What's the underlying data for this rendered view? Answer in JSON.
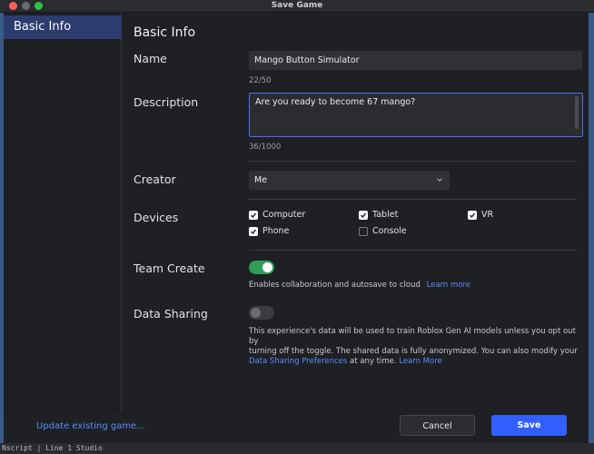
{
  "window": {
    "title": "Save Game"
  },
  "sidebar": {
    "items": [
      {
        "label": "Basic Info"
      }
    ]
  },
  "section": {
    "title": "Basic Info"
  },
  "name": {
    "label": "Name",
    "value": "Mango Button Simulator",
    "counter": "22/50"
  },
  "description": {
    "label": "Description",
    "value": "Are you ready to become 67 mango?",
    "counter": "36/1000"
  },
  "creator": {
    "label": "Creator",
    "selected": "Me"
  },
  "devices": {
    "label": "Devices",
    "options": [
      {
        "label": "Computer",
        "checked": true
      },
      {
        "label": "Tablet",
        "checked": true
      },
      {
        "label": "VR",
        "checked": true
      },
      {
        "label": "Phone",
        "checked": true
      },
      {
        "label": "Console",
        "checked": false
      }
    ]
  },
  "team_create": {
    "label": "Team Create",
    "enabled": true,
    "help": "Enables collaboration and autosave to cloud",
    "learn_more": "Learn more"
  },
  "data_sharing": {
    "label": "Data Sharing",
    "enabled": false,
    "help_line1": "This experience's data will be used to train Roblox Gen AI models unless you opt out by",
    "help_line2": "turning off the toggle. The shared data is fully anonymized. You can also modify your",
    "prefs_link": "Data Sharing Preferences",
    "help_tail": " at any time. ",
    "learn_more": "Learn More"
  },
  "footer": {
    "update_link": "Update existing game...",
    "cancel_label": "Cancel",
    "save_label": "Save"
  },
  "background": {
    "status_text": "Nscript | Line 1    Studio"
  },
  "colors": {
    "accent": "#335fff",
    "link": "#5d8cf6",
    "toggle_on": "#2f9e58",
    "sidebar_selected": "#2d3c6e"
  }
}
